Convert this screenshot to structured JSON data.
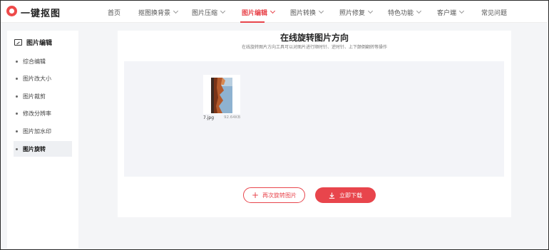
{
  "brand": {
    "name": "一键抠图"
  },
  "nav": {
    "items": [
      {
        "label": "首页",
        "has_dropdown": false,
        "active": false
      },
      {
        "label": "抠图换背景",
        "has_dropdown": true,
        "active": false
      },
      {
        "label": "图片压缩",
        "has_dropdown": true,
        "active": false
      },
      {
        "label": "图片编辑",
        "has_dropdown": true,
        "active": true
      },
      {
        "label": "图片转换",
        "has_dropdown": true,
        "active": false
      },
      {
        "label": "照片修复",
        "has_dropdown": true,
        "active": false
      },
      {
        "label": "特色功能",
        "has_dropdown": true,
        "active": false
      },
      {
        "label": "客户端",
        "has_dropdown": true,
        "active": false
      },
      {
        "label": "常见问题",
        "has_dropdown": false,
        "active": false
      }
    ]
  },
  "sidebar": {
    "title": "图片编辑",
    "icon": "edit-image-icon",
    "items": [
      {
        "label": "综合编辑",
        "active": false
      },
      {
        "label": "图片改大小",
        "active": false
      },
      {
        "label": "图片裁剪",
        "active": false
      },
      {
        "label": "修改分辨率",
        "active": false
      },
      {
        "label": "图片加水印",
        "active": false
      },
      {
        "label": "图片旋转",
        "active": true
      }
    ]
  },
  "main": {
    "title": "在线旋转图片方向",
    "subtitle": "在线旋转图片方向工具可以对图片进行顺时针、逆时针、上下颠倒翻转等操作",
    "file": {
      "name": "7.jpg",
      "size": "92.64KB"
    },
    "buttons": {
      "rotate_again": "再次旋转图片",
      "download": "立即下载"
    }
  },
  "colors": {
    "accent": "#e8454c",
    "panel": "#f3f4f8",
    "page_bg": "#f4f5f7"
  }
}
